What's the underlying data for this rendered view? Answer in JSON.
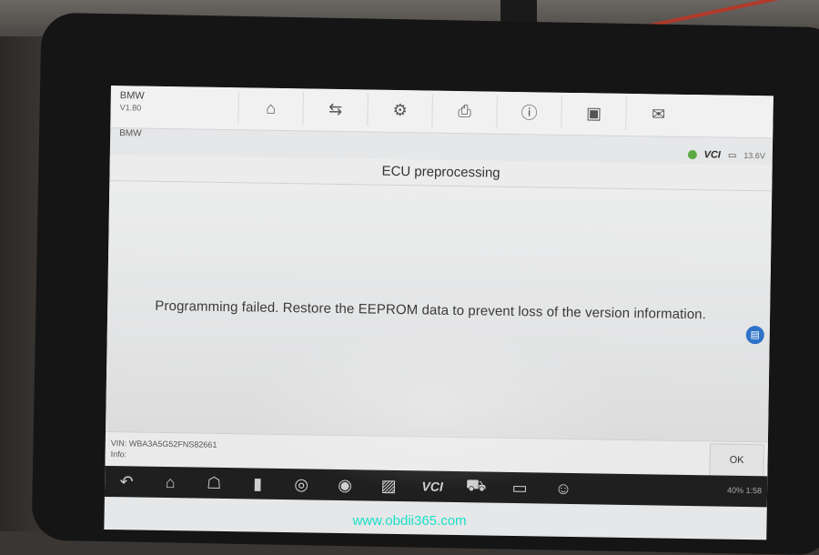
{
  "app": {
    "brand": "BMW",
    "version": "V1.80",
    "breadcrumb": "BMW"
  },
  "toolbar": {
    "icons": [
      "home-icon",
      "vehicle-swap-icon",
      "settings-icon",
      "print-icon",
      "help-icon",
      "save-icon",
      "message-icon"
    ]
  },
  "status": {
    "vci_label": "VCI",
    "battery_voltage": "13.6V"
  },
  "dialog": {
    "title": "ECU preprocessing",
    "message": "Programming failed. Restore the EEPROM data to prevent loss of the version information.",
    "ok_label": "OK"
  },
  "footer": {
    "vin_line": "VIN: WBA3A5G52FNS82661",
    "info_line": "Info:"
  },
  "navbar": {
    "vci_label": "VCI",
    "status_text": "40% 1:58"
  },
  "watermark": "www.obdii365.com",
  "colors": {
    "accent_blue": "#2f73c9",
    "vci_green": "#5aa942",
    "watermark": "#19e0c8"
  }
}
